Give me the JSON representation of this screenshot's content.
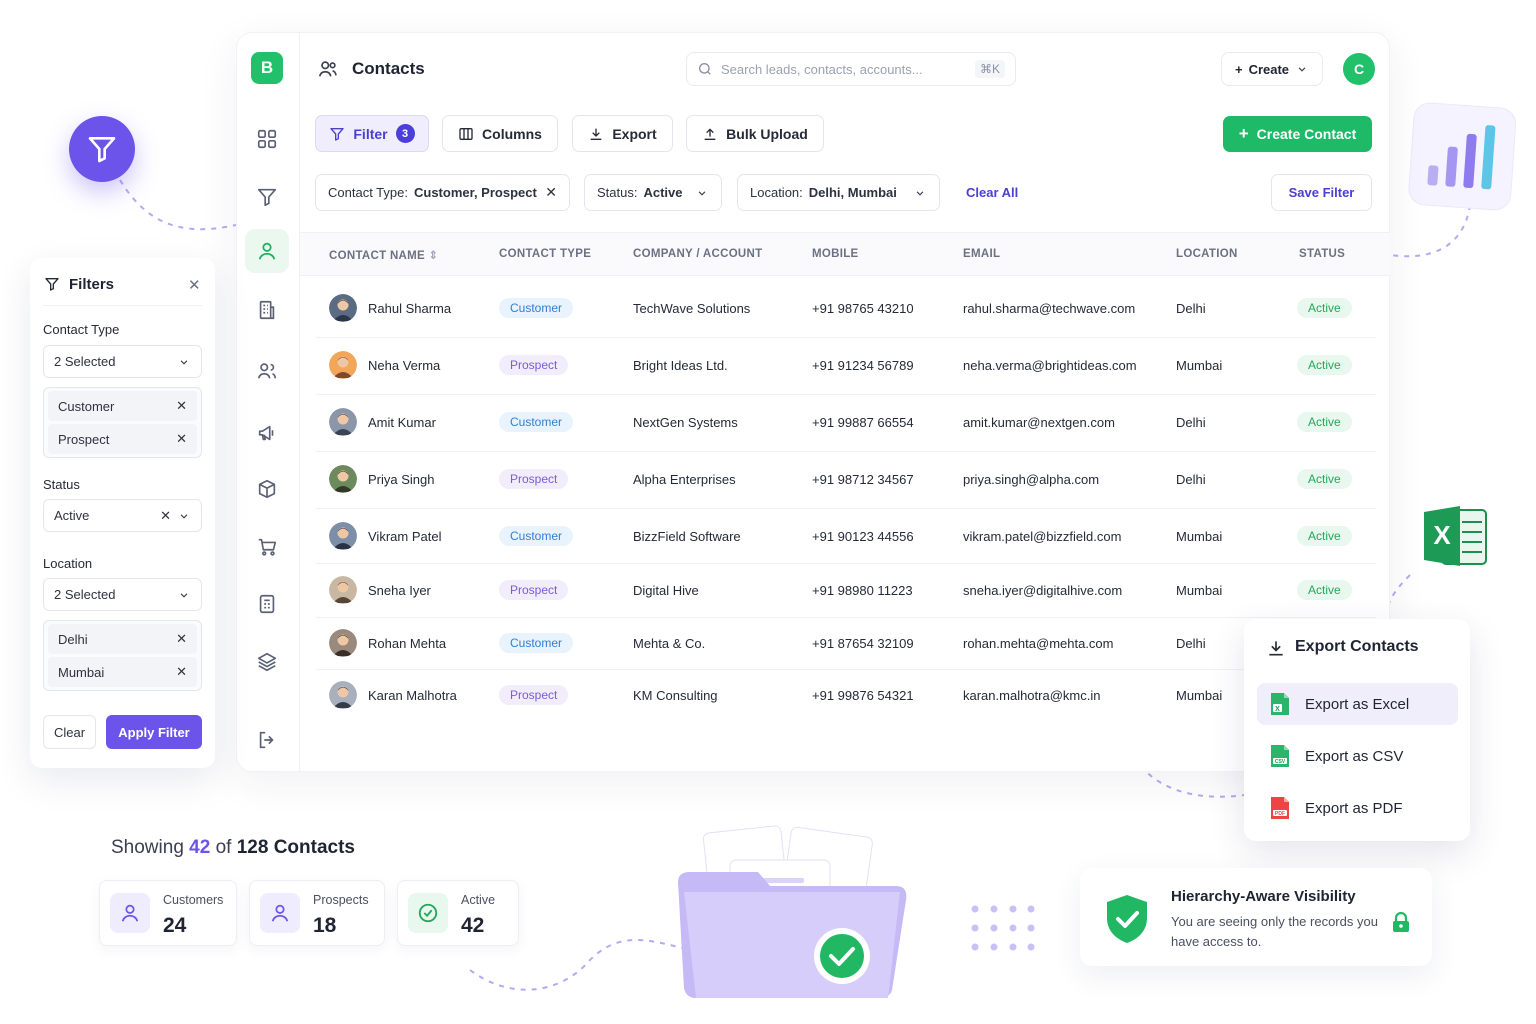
{
  "app": {
    "logo_letter": "B",
    "page_title": "Contacts",
    "search_placeholder": "Search leads, contacts, accounts...",
    "search_shortcut": "⌘K",
    "create_label": "Create",
    "user_initial": "C"
  },
  "toolbar": {
    "filter_label": "Filter",
    "filter_count": "3",
    "columns_label": "Columns",
    "export_label": "Export",
    "bulk_upload_label": "Bulk Upload",
    "create_contact_label": "Create Contact"
  },
  "active_filters": {
    "contact_type_label": "Contact Type:",
    "contact_type_value": "Customer, Prospect",
    "status_label": "Status:",
    "status_value": "Active",
    "location_label": "Location:",
    "location_value": "Delhi, Mumbai",
    "clear_all": "Clear All",
    "save_filter": "Save Filter"
  },
  "table": {
    "columns": [
      "CONTACT NAME",
      "CONTACT TYPE",
      "COMPANY / ACCOUNT",
      "MOBILE",
      "EMAIL",
      "LOCATION",
      "STATUS"
    ],
    "rows": [
      {
        "name": "Rahul Sharma",
        "type": "Customer",
        "company": "TechWave Solutions",
        "mobile": "+91 98765 43210",
        "email": "rahul.sharma@techwave.com",
        "location": "Delhi",
        "status": "Active"
      },
      {
        "name": "Neha Verma",
        "type": "Prospect",
        "company": "Bright Ideas Ltd.",
        "mobile": "+91 91234 56789",
        "email": "neha.verma@brightideas.com",
        "location": "Mumbai",
        "status": "Active"
      },
      {
        "name": "Amit Kumar",
        "type": "Customer",
        "company": "NextGen Systems",
        "mobile": "+91 99887 66554",
        "email": "amit.kumar@nextgen.com",
        "location": "Delhi",
        "status": "Active"
      },
      {
        "name": "Priya Singh",
        "type": "Prospect",
        "company": "Alpha Enterprises",
        "mobile": "+91 98712 34567",
        "email": "priya.singh@alpha.com",
        "location": "Delhi",
        "status": "Active"
      },
      {
        "name": "Vikram Patel",
        "type": "Customer",
        "company": "BizzField Software",
        "mobile": "+91 90123 44556",
        "email": "vikram.patel@bizzfield.com",
        "location": "Mumbai",
        "status": "Active"
      },
      {
        "name": "Sneha Iyer",
        "type": "Prospect",
        "company": "Digital Hive",
        "mobile": "+91 98980 11223",
        "email": "sneha.iyer@digitalhive.com",
        "location": "Mumbai",
        "status": "Active"
      },
      {
        "name": "Rohan Mehta",
        "type": "Customer",
        "company": "Mehta & Co.",
        "mobile": "+91 87654 32109",
        "email": "rohan.mehta@mehta.com",
        "location": "Delhi",
        "status": ""
      },
      {
        "name": "Karan Malhotra",
        "type": "Prospect",
        "company": "KM Consulting",
        "mobile": "+91 99876 54321",
        "email": "karan.malhotra@kmc.in",
        "location": "Mumbai",
        "status": ""
      }
    ]
  },
  "filters_panel": {
    "title": "Filters",
    "contact_type_label": "Contact Type",
    "contact_type_select": "2 Selected",
    "contact_type_chips": [
      "Customer",
      "Prospect"
    ],
    "status_label": "Status",
    "status_select": "Active",
    "location_label": "Location",
    "location_select": "2 Selected",
    "location_chips": [
      "Delhi",
      "Mumbai"
    ],
    "clear_label": "Clear",
    "apply_label": "Apply Filter"
  },
  "export_menu": {
    "title": "Export Contacts",
    "items": [
      "Export as Excel",
      "Export as CSV",
      "Export as PDF"
    ]
  },
  "summary": {
    "showing_prefix": "Showing",
    "showing_count": "42",
    "showing_mid": "of",
    "showing_total": "128 Contacts",
    "stats": [
      {
        "label": "Customers",
        "value": "24"
      },
      {
        "label": "Prospects",
        "value": "18"
      },
      {
        "label": "Active",
        "value": "42"
      }
    ]
  },
  "hierarchy": {
    "title": "Hierarchy-Aware Visibility",
    "text": "You are seeing only the records you have access to."
  },
  "colors": {
    "brand_green": "#22c06a",
    "accent_purple": "#6c53ea",
    "customer_blue": "#2f7fd6",
    "prospect_purple": "#7a5bd6",
    "active_green": "#22a85a"
  },
  "icons": {
    "rail": [
      "dashboard-icon",
      "funnel-icon",
      "user-icon",
      "building-icon",
      "users-icon",
      "megaphone-icon",
      "box-icon",
      "cart-icon",
      "calculator-icon",
      "layers-icon",
      "logout-icon"
    ]
  }
}
